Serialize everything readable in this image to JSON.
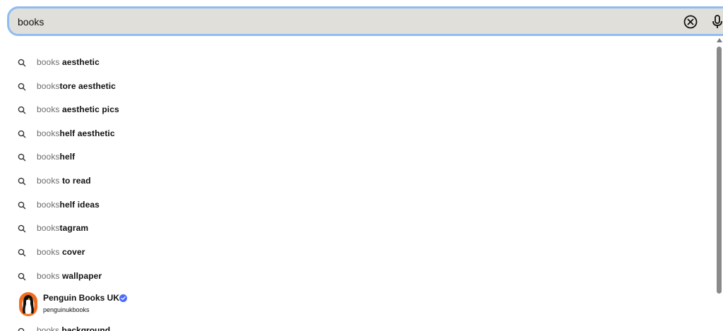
{
  "search": {
    "value": "books",
    "clear_icon": "close-circle-icon",
    "mic_icon": "microphone-icon"
  },
  "suggestions": [
    {
      "typed": "books",
      "rest": " aesthetic"
    },
    {
      "typed": "books",
      "rest": "tore aesthetic"
    },
    {
      "typed": "books",
      "rest": " aesthetic pics"
    },
    {
      "typed": "books",
      "rest": "helf aesthetic"
    },
    {
      "typed": "books",
      "rest": "helf"
    },
    {
      "typed": "books",
      "rest": " to read"
    },
    {
      "typed": "books",
      "rest": "helf ideas"
    },
    {
      "typed": "books",
      "rest": "tagram"
    },
    {
      "typed": "books",
      "rest": " cover"
    },
    {
      "typed": "books",
      "rest": " wallpaper"
    }
  ],
  "profile": {
    "name": "Penguin Books UK",
    "username": "penguinukbooks",
    "verified_icon": "verified-badge-icon",
    "avatar_color": "#f26c21"
  },
  "partial_suggestion": {
    "typed": "books",
    "rest": " background"
  },
  "colors": {
    "search_bg": "#e1dfd9",
    "focus_ring": "#8fbdf2",
    "verified": "#4a6cf7"
  }
}
